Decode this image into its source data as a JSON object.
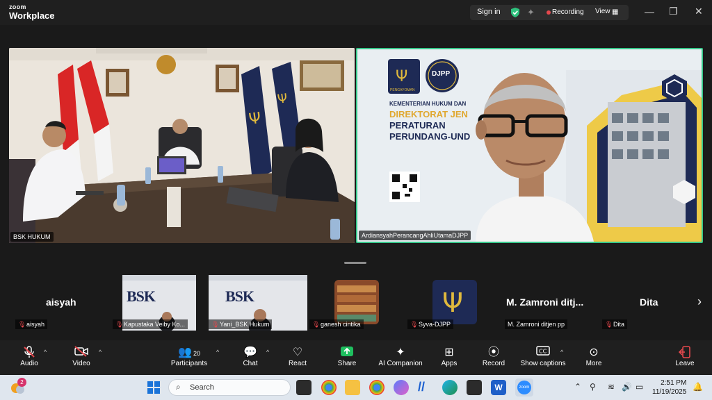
{
  "app": {
    "brand_small": "zoom",
    "brand_large": "Workplace"
  },
  "titlebar": {
    "sign_in": "Sign in",
    "recording": "Recording",
    "view": "View"
  },
  "main_tiles": [
    {
      "name": "BSK HUKUM"
    },
    {
      "name": "ArdiansyahPerancangAhliUtamaDJPP"
    }
  ],
  "slide": {
    "logo1": "PENGAYOMAN",
    "logo2": "DJPP",
    "line1": "KEMENTERIAN HUKUM DAN",
    "line2": "DIREKTORAT JEN",
    "line3": "PERATURAN",
    "line4": "PERUNDANG-UND"
  },
  "participants_strip": [
    {
      "display": "aisyah",
      "label": "aisyah"
    },
    {
      "display": "BSK",
      "label": "Kapustaka Veiby Ko..."
    },
    {
      "display": "BSK",
      "label": "Yani_BSK Hukum"
    },
    {
      "display": "",
      "label": "ganesh cintika"
    },
    {
      "display": "",
      "label": "Syva-DJPP"
    },
    {
      "display": "M. Zamroni  ditj...",
      "label": "M. Zamroni ditjen pp"
    },
    {
      "display": "Dita",
      "label": "Dita"
    }
  ],
  "toolbar": {
    "audio": "Audio",
    "video": "Video",
    "participants": "Participants",
    "participants_count": "20",
    "chat": "Chat",
    "react": "React",
    "share": "Share",
    "ai_companion": "AI Companion",
    "apps": "Apps",
    "record": "Record",
    "show_captions": "Show captions",
    "more": "More",
    "leave": "Leave"
  },
  "taskbar": {
    "search_placeholder": "Search",
    "time": "2:51 PM",
    "date": "11/19/2025",
    "notification_badge": "2"
  },
  "colors": {
    "accent_green": "#36c78a",
    "share_green": "#1fbf5f",
    "muted_red": "#e5484d",
    "leave_red": "#e5484d"
  }
}
